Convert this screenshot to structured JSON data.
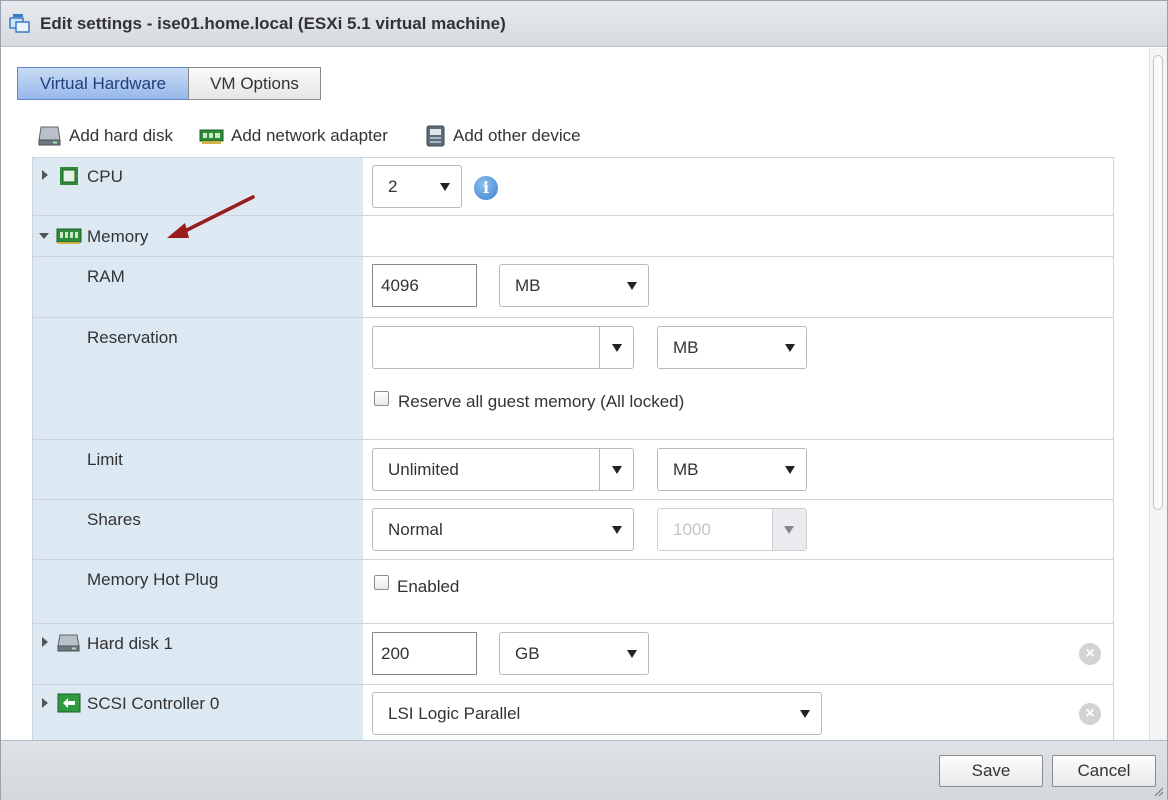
{
  "window": {
    "title": "Edit settings - ise01.home.local (ESXi 5.1 virtual machine)"
  },
  "tabs": [
    {
      "label": "Virtual Hardware",
      "active": true
    },
    {
      "label": "VM Options",
      "active": false
    }
  ],
  "toolbar": {
    "add_hard_disk": "Add hard disk",
    "add_network_adapter": "Add network adapter",
    "add_other_device": "Add other device"
  },
  "cpu": {
    "label": "CPU",
    "value": "2"
  },
  "memory": {
    "label": "Memory",
    "ram": {
      "label": "RAM",
      "value": "4096",
      "unit": "MB"
    },
    "reservation": {
      "label": "Reservation",
      "value": "",
      "unit": "MB",
      "reserve_all_label": "Reserve all guest memory (All locked)",
      "reserve_all_checked": false
    },
    "limit": {
      "label": "Limit",
      "value": "Unlimited",
      "unit": "MB"
    },
    "shares": {
      "label": "Shares",
      "value": "Normal",
      "amount": "1000"
    },
    "hot_plug": {
      "label": "Memory Hot Plug",
      "enabled_label": "Enabled",
      "enabled_checked": false
    }
  },
  "hard_disk": {
    "label": "Hard disk 1",
    "value": "200",
    "unit": "GB"
  },
  "scsi": {
    "label": "SCSI Controller 0",
    "value": "LSI Logic Parallel"
  },
  "footer": {
    "save": "Save",
    "cancel": "Cancel"
  },
  "colors": {
    "accent": "#97b8ec",
    "row_label_bg": "#dce8f2",
    "arrow": "#9b1c1c"
  }
}
